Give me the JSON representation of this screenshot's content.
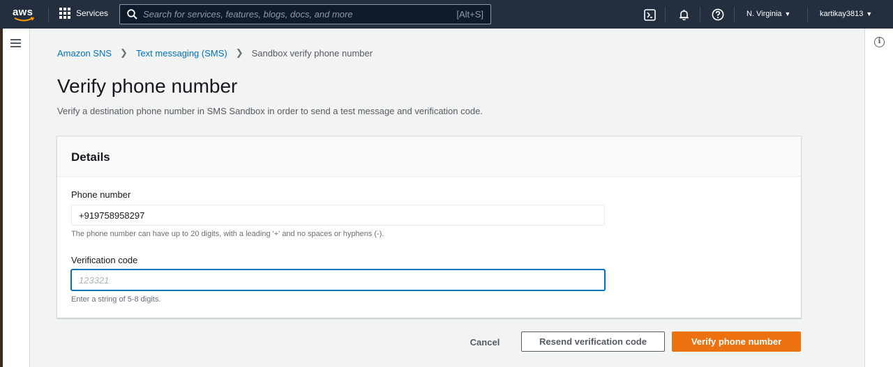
{
  "topnav": {
    "logo_text": "aws",
    "services_label": "Services",
    "search_placeholder": "Search for services, features, blogs, docs, and more",
    "search_shortcut": "[Alt+S]",
    "region": "N. Virginia",
    "account": "kartikay3813"
  },
  "breadcrumb": {
    "items": [
      "Amazon SNS",
      "Text messaging (SMS)",
      "Sandbox verify phone number"
    ]
  },
  "page": {
    "title": "Verify phone number",
    "description": "Verify a destination phone number in SMS Sandbox in order to send a test message and verification code."
  },
  "details": {
    "header": "Details",
    "phone_label": "Phone number",
    "phone_value": "+919758958297",
    "phone_hint": "The phone number can have up to 20 digits, with a leading '+' and no spaces or hyphens (-).",
    "code_label": "Verification code",
    "code_placeholder": "123321",
    "code_hint": "Enter a string of 5-8 digits."
  },
  "actions": {
    "cancel": "Cancel",
    "resend": "Resend verification code",
    "verify": "Verify phone number"
  },
  "colors": {
    "nav_bg": "#232f3e",
    "link": "#0073bb",
    "primary": "#ec7211"
  }
}
